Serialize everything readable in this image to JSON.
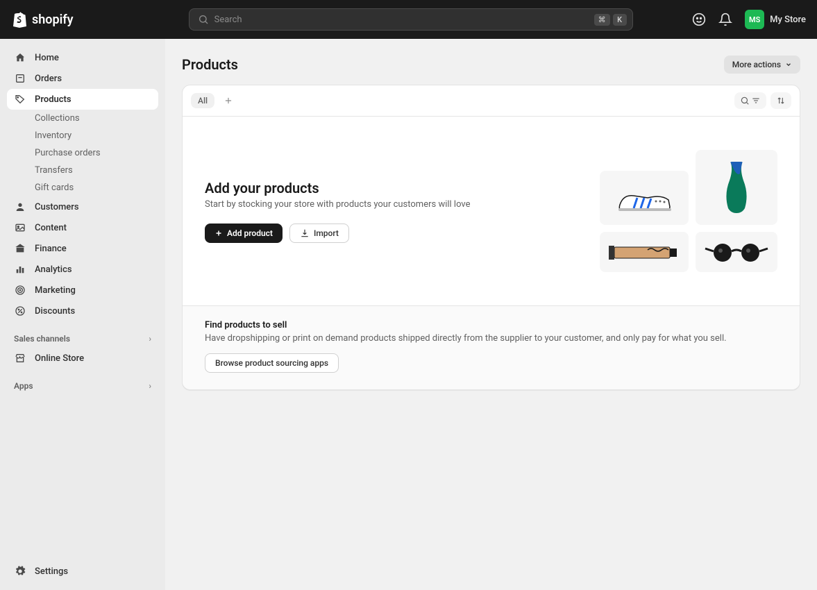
{
  "brand": "shopify",
  "search": {
    "placeholder": "Search",
    "kbd1": "⌘",
    "kbd2": "K"
  },
  "store": {
    "initials": "MS",
    "name": "My Store"
  },
  "nav": {
    "home": "Home",
    "orders": "Orders",
    "products": "Products",
    "customers": "Customers",
    "content": "Content",
    "finance": "Finance",
    "analytics": "Analytics",
    "marketing": "Marketing",
    "discounts": "Discounts",
    "settings": "Settings"
  },
  "subnav": {
    "collections": "Collections",
    "inventory": "Inventory",
    "purchase_orders": "Purchase orders",
    "transfers": "Transfers",
    "gift_cards": "Gift cards"
  },
  "sections": {
    "sales_channels": "Sales channels",
    "online_store": "Online Store",
    "apps": "Apps"
  },
  "page": {
    "title": "Products",
    "more_actions": "More actions"
  },
  "tabs": {
    "all": "All"
  },
  "empty": {
    "title": "Add your products",
    "subtitle": "Start by stocking your store with products your customers will love",
    "add_btn": "Add product",
    "import_btn": "Import"
  },
  "find": {
    "title": "Find products to sell",
    "subtitle": "Have dropshipping or print on demand products shipped directly from the supplier to your customer, and only pay for what you sell.",
    "browse_btn": "Browse product sourcing apps"
  }
}
